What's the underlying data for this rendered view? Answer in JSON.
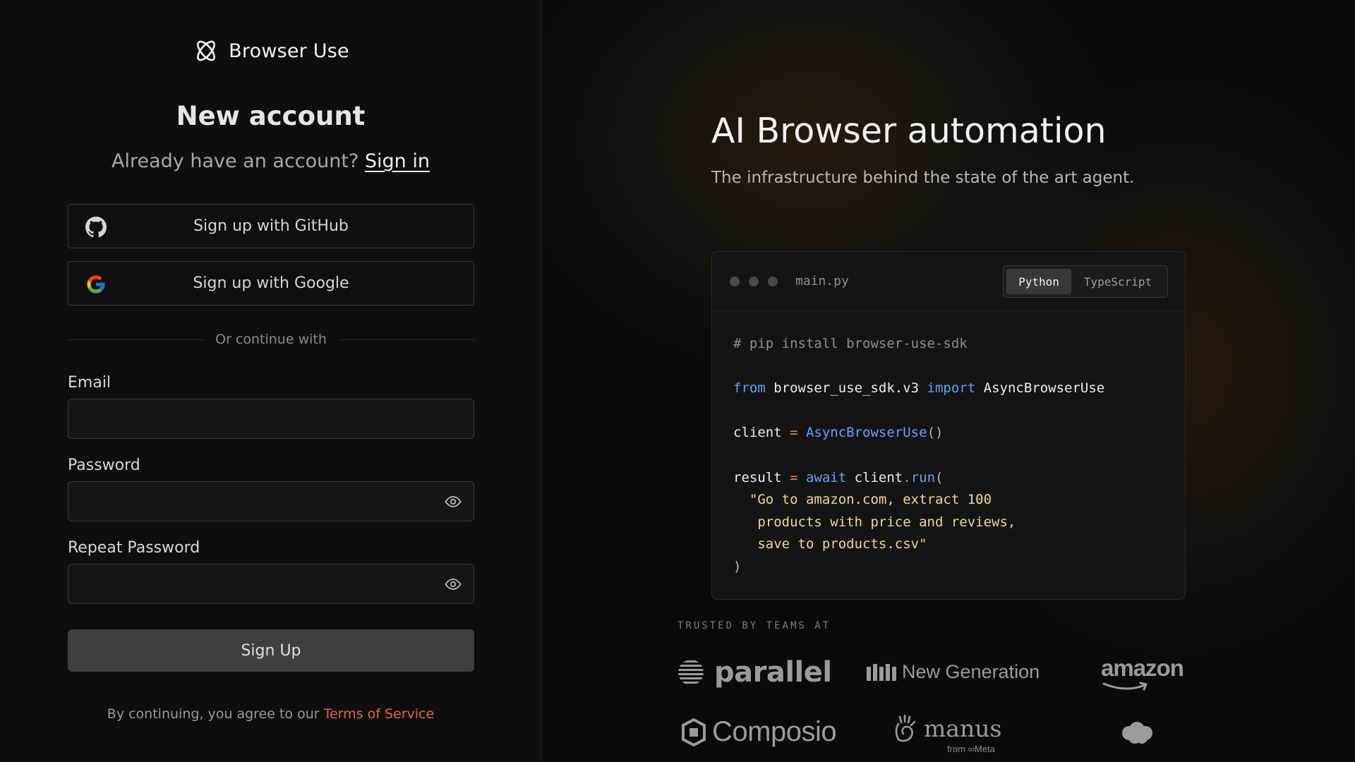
{
  "brand": {
    "name": "Browser Use",
    "logo_icon": "browser-use-logo-icon"
  },
  "auth": {
    "heading": "New account",
    "already_text": "Already have an account?",
    "sign_in_link": "Sign in",
    "github_button": "Sign up with GitHub",
    "google_button": "Sign up with Google",
    "divider_text": "Or continue with",
    "fields": {
      "email_label": "Email",
      "email_value": "",
      "password_label": "Password",
      "password_value": "",
      "repeat_password_label": "Repeat Password",
      "repeat_password_value": ""
    },
    "submit_label": "Sign Up",
    "terms_prefix": "By continuing, you agree to our",
    "terms_link": "Terms of Service",
    "accent_color": "#e8663c"
  },
  "hero": {
    "title": "AI Browser automation",
    "subtitle": "The infrastructure behind the state of the art agent."
  },
  "code": {
    "filename": "main.py",
    "tabs": [
      "Python",
      "TypeScript"
    ],
    "active_tab": "Python",
    "lines": {
      "comment": "# pip install browser-use-sdk",
      "import_from": "from",
      "import_module": " browser_use_sdk.v3 ",
      "import_kw": "import",
      "import_name": " AsyncBrowserUse",
      "client_var": "client ",
      "client_eq": "=",
      "client_ctor": " AsyncBrowserUse",
      "client_parens": "()",
      "result_var": "result ",
      "result_eq": "=",
      "result_await": " await",
      "result_client": " client",
      "result_run": ".run",
      "result_open": "(",
      "str_line1": "  \"Go to amazon.com, extract 100",
      "str_line2": "   products with price and reviews,",
      "str_line3": "   save to products.csv\"",
      "close_paren": ")"
    }
  },
  "trusted": {
    "label": "TRUSTED BY TEAMS AT",
    "logos": {
      "parallel": "parallel",
      "new_generation": "New Generation",
      "amazon": "amazon",
      "composio": "Composio",
      "manus": "manus",
      "manus_sub": "from ∞Meta",
      "salesforce_icon": "salesforce-cloud-icon"
    }
  }
}
